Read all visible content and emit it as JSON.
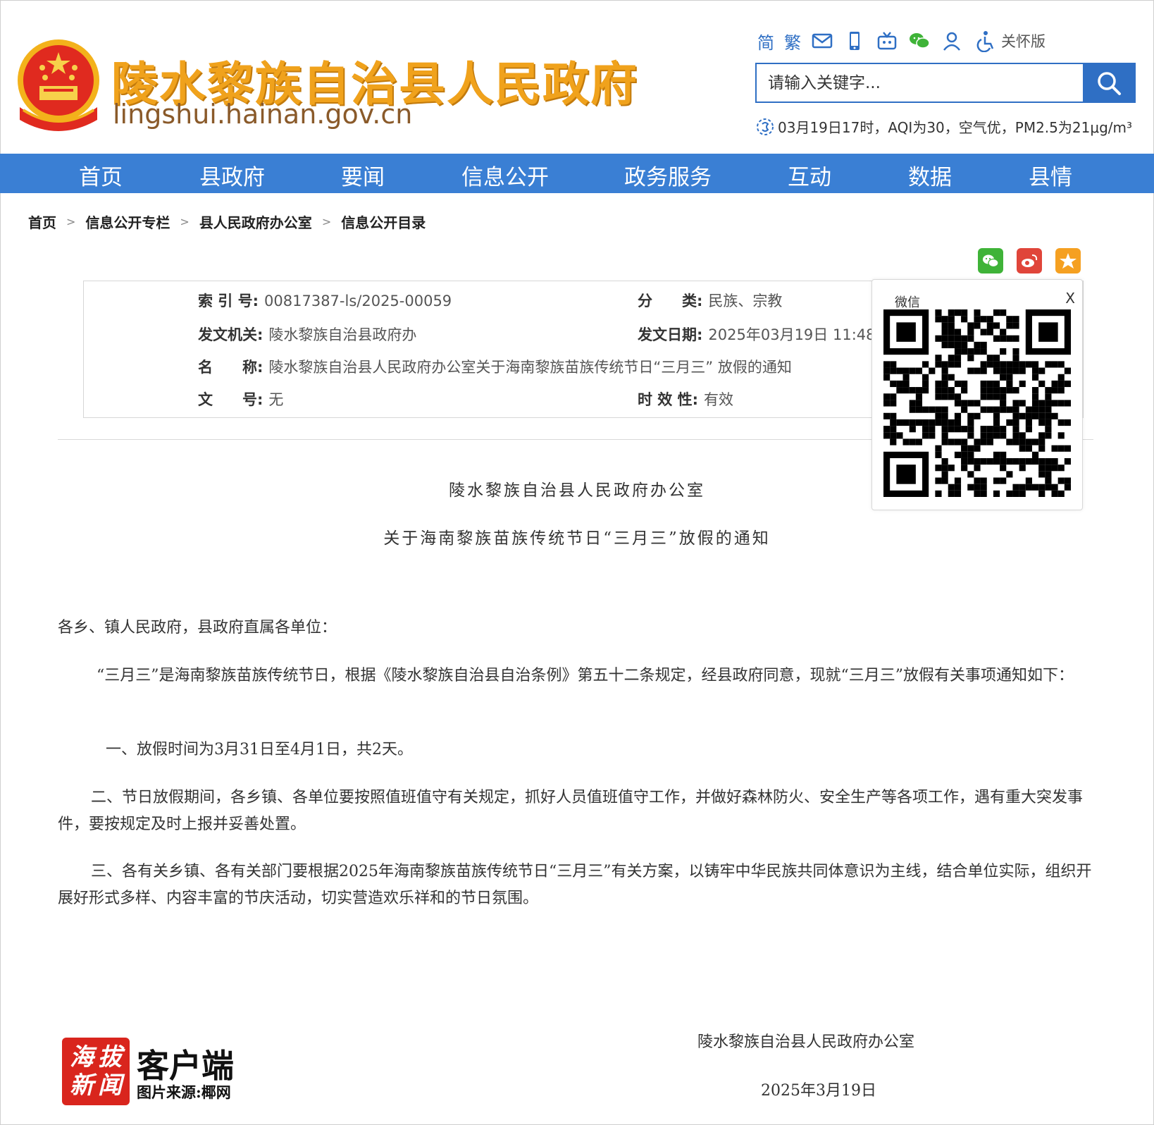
{
  "header": {
    "site_title": "陵水黎族自治县人民政府",
    "site_domain": "lingshui.hainan.gov.cn",
    "toolbar": {
      "simplified": "简",
      "traditional": "繁",
      "care_mode": "关怀版"
    },
    "search": {
      "placeholder": "请输入关键字..."
    },
    "aqi_text": "03月19日17时，AQI为30，空气优，PM2.5为21μg/m³"
  },
  "nav": {
    "items": [
      "首页",
      "县政府",
      "要闻",
      "信息公开",
      "政务服务",
      "互动",
      "数据",
      "县情"
    ]
  },
  "breadcrumb": [
    "首页",
    "信息公开专栏",
    "县人民政府办公室",
    "信息公开目录"
  ],
  "info": {
    "index_label": "索 引 号:",
    "index_value": "00817387-ls/2025-00059",
    "category_label": "分　　类:",
    "category_value": "民族、宗教",
    "issuer_label": "发文机关:",
    "issuer_value": "陵水黎族自治县政府办",
    "date_label": "发文日期:",
    "date_value": "2025年03月19日 11:48",
    "name_label": "名　　称:",
    "name_value": "陵水黎族自治县人民政府办公室关于海南黎族苗族传统节日“三月三” 放假的通知",
    "doc_no_label": "文　　号:",
    "doc_no_value": "无",
    "validity_label": "时 效 性:",
    "validity_value": "有效"
  },
  "qr_popup": {
    "title": "微信",
    "close": "X"
  },
  "article": {
    "title_line1": "陵水黎族自治县人民政府办公室",
    "title_line2": "关于海南黎族苗族传统节日“三月三”放假的通知",
    "salutation": "各乡、镇人民政府，县政府直属各单位：",
    "p1": "“三月三”是海南黎族苗族传统节日，根据《陵水黎族自治县自治条例》第五十二条规定，经县政府同意，现就“三月三”放假有关事项通知如下：",
    "p2": "一、放假时间为3月31日至4月1日，共2天。",
    "p3": "二、节日放假期间，各乡镇、各单位要按照值班值守有关规定，抓好人员值班值守工作，并做好森林防火、安全生产等各项工作，遇有重大突发事件，要按规定及时上报并妥善处置。",
    "p4": "三、各有关乡镇、各有关部门要根据2025年海南黎族苗族传统节日“三月三”有关方案，以铸牢中华民族共同体意识为主线，结合单位实际，组织开展好形式多样、内容丰富的节庆活动，切实营造欢乐祥和的节日氛围。",
    "signature": "陵水黎族自治县人民政府办公室",
    "sign_date": "2025年3月19日"
  },
  "watermark": {
    "logo_chars": [
      "海",
      "拔",
      "新",
      "闻"
    ],
    "app_text": "客户端",
    "source": "图片来源:椰网"
  },
  "colors": {
    "nav_blue": "#3a7fd4",
    "accent_blue": "#2f6fc4",
    "title_gold": "#f0a21c",
    "wechat_green": "#3fb338",
    "weibo_red": "#e0453a",
    "star_orange": "#f5a021",
    "watermark_red": "#d9251d"
  }
}
